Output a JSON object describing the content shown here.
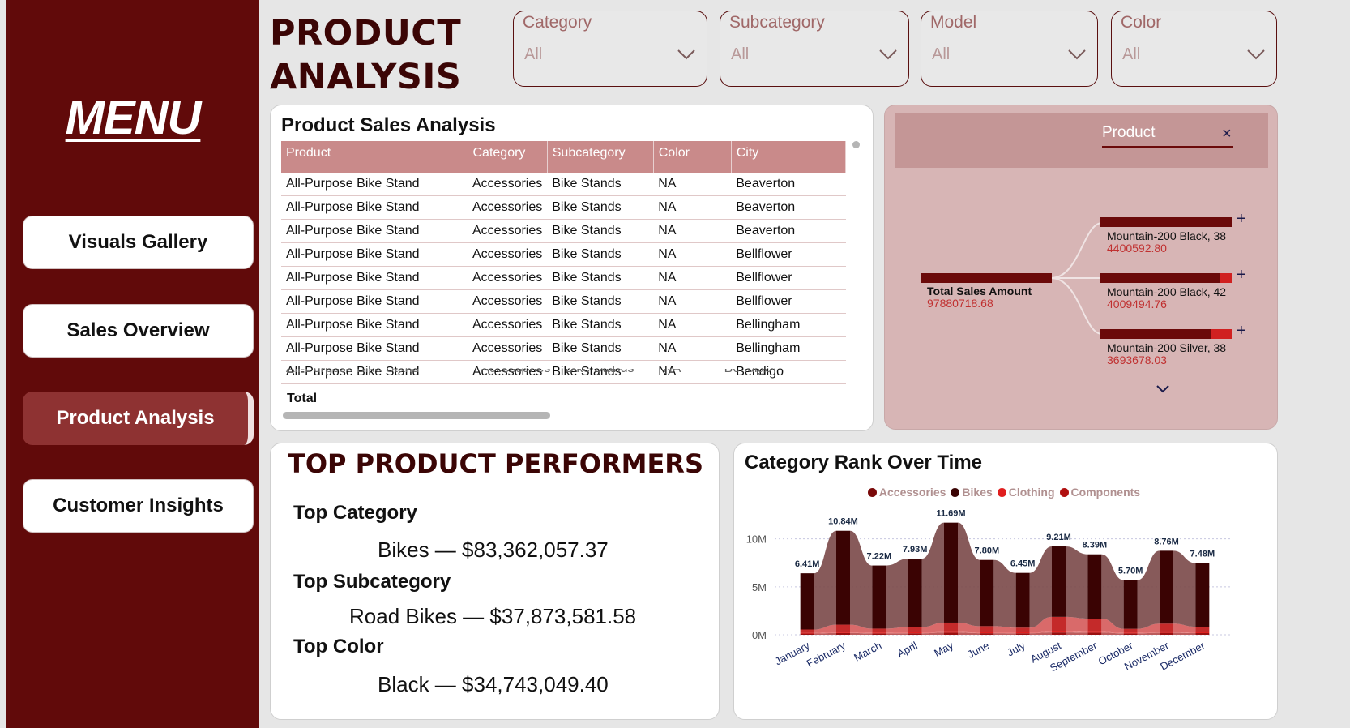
{
  "sidebar": {
    "title": "MENU",
    "buttons": [
      {
        "label": "Visuals Gallery",
        "active": false
      },
      {
        "label": "Sales Overview",
        "active": false
      },
      {
        "label": "Product Analysis",
        "active": true
      },
      {
        "label": "Customer Insights",
        "active": false
      }
    ]
  },
  "header": {
    "title_line1": "PRODUCT",
    "title_line2": "ANALYSIS"
  },
  "slicers": [
    {
      "label": "Category",
      "value": "All"
    },
    {
      "label": "Subcategory",
      "value": "All"
    },
    {
      "label": "Model",
      "value": "All"
    },
    {
      "label": "Color",
      "value": "All"
    }
  ],
  "sales_table": {
    "title": "Product Sales Analysis",
    "columns": [
      "Product",
      "Category",
      "Subcategory",
      "Color",
      "City"
    ],
    "rows": [
      [
        "All-Purpose Bike Stand",
        "Accessories",
        "Bike Stands",
        "NA",
        "Beaverton"
      ],
      [
        "All-Purpose Bike Stand",
        "Accessories",
        "Bike Stands",
        "NA",
        "Beaverton"
      ],
      [
        "All-Purpose Bike Stand",
        "Accessories",
        "Bike Stands",
        "NA",
        "Beaverton"
      ],
      [
        "All-Purpose Bike Stand",
        "Accessories",
        "Bike Stands",
        "NA",
        "Bellflower"
      ],
      [
        "All-Purpose Bike Stand",
        "Accessories",
        "Bike Stands",
        "NA",
        "Bellflower"
      ],
      [
        "All-Purpose Bike Stand",
        "Accessories",
        "Bike Stands",
        "NA",
        "Bellflower"
      ],
      [
        "All-Purpose Bike Stand",
        "Accessories",
        "Bike Stands",
        "NA",
        "Bellingham"
      ],
      [
        "All-Purpose Bike Stand",
        "Accessories",
        "Bike Stands",
        "NA",
        "Bellingham"
      ],
      [
        "All-Purpose Bike Stand",
        "Accessories",
        "Bike Stands",
        "NA",
        "Bendigo"
      ]
    ],
    "total_label": "Total"
  },
  "decomposition": {
    "header": "Product",
    "close": "×",
    "root": {
      "label": "Total Sales Amount",
      "value": "97880718.68"
    },
    "nodes": [
      {
        "label": "Mountain-200 Black, 38",
        "value": "4400592.80",
        "share": 1.0
      },
      {
        "label": "Mountain-200 Black, 42",
        "value": "4009494.76",
        "share": 0.91
      },
      {
        "label": "Mountain-200 Silver, 38",
        "value": "3693678.03",
        "share": 0.84
      }
    ]
  },
  "top_performers": {
    "title": "TOP PRODUCT PERFORMERS",
    "items": [
      {
        "heading": "Top Category",
        "value": "Bikes — $83,362,057.37"
      },
      {
        "heading": "Top Subcategory",
        "value": "Road Bikes — $37,873,581.58"
      },
      {
        "heading": "Top Color",
        "value": "Black — $34,743,049.40"
      }
    ]
  },
  "colors": {
    "sidebar": "#610a0a",
    "accent": "#8e3232",
    "table_header": "#c98a8a",
    "accessories": "#7a0a0a",
    "bikes": "#3a0303",
    "clothing": "#e01e1e",
    "components": "#b01010"
  },
  "chart_data": {
    "type": "area",
    "title": "Category Rank Over Time",
    "legend": [
      "Accessories",
      "Bikes",
      "Clothing",
      "Components"
    ],
    "legend_position": "top-center",
    "categories": [
      "January",
      "February",
      "March",
      "April",
      "May",
      "June",
      "July",
      "August",
      "September",
      "October",
      "November",
      "December"
    ],
    "totals": [
      6.41,
      10.84,
      7.22,
      7.93,
      11.69,
      7.8,
      6.45,
      9.21,
      8.39,
      5.7,
      8.76,
      7.48
    ],
    "total_labels": [
      "6.41M",
      "10.84M",
      "7.22M",
      "7.93M",
      "11.69M",
      "7.80M",
      "6.45M",
      "9.21M",
      "8.39M",
      "5.70M",
      "8.76M",
      "7.48M"
    ],
    "series": [
      {
        "name": "Accessories",
        "values": [
          0.12,
          0.18,
          0.14,
          0.15,
          0.22,
          0.16,
          0.15,
          0.24,
          0.22,
          0.14,
          0.2,
          0.17
        ]
      },
      {
        "name": "Clothing",
        "values": [
          0.08,
          0.12,
          0.1,
          0.11,
          0.15,
          0.12,
          0.11,
          0.18,
          0.17,
          0.1,
          0.14,
          0.12
        ]
      },
      {
        "name": "Components",
        "values": [
          0.35,
          0.75,
          0.4,
          0.55,
          0.9,
          0.62,
          0.48,
          1.45,
          1.3,
          0.38,
          0.82,
          0.55
        ]
      },
      {
        "name": "Bikes",
        "values": [
          5.86,
          9.79,
          6.58,
          7.12,
          10.42,
          6.9,
          5.71,
          7.34,
          6.7,
          5.08,
          7.6,
          6.64
        ]
      }
    ],
    "y_ticks": [
      "0M",
      "5M",
      "10M"
    ],
    "ylim": [
      0,
      12
    ],
    "grid": true
  }
}
